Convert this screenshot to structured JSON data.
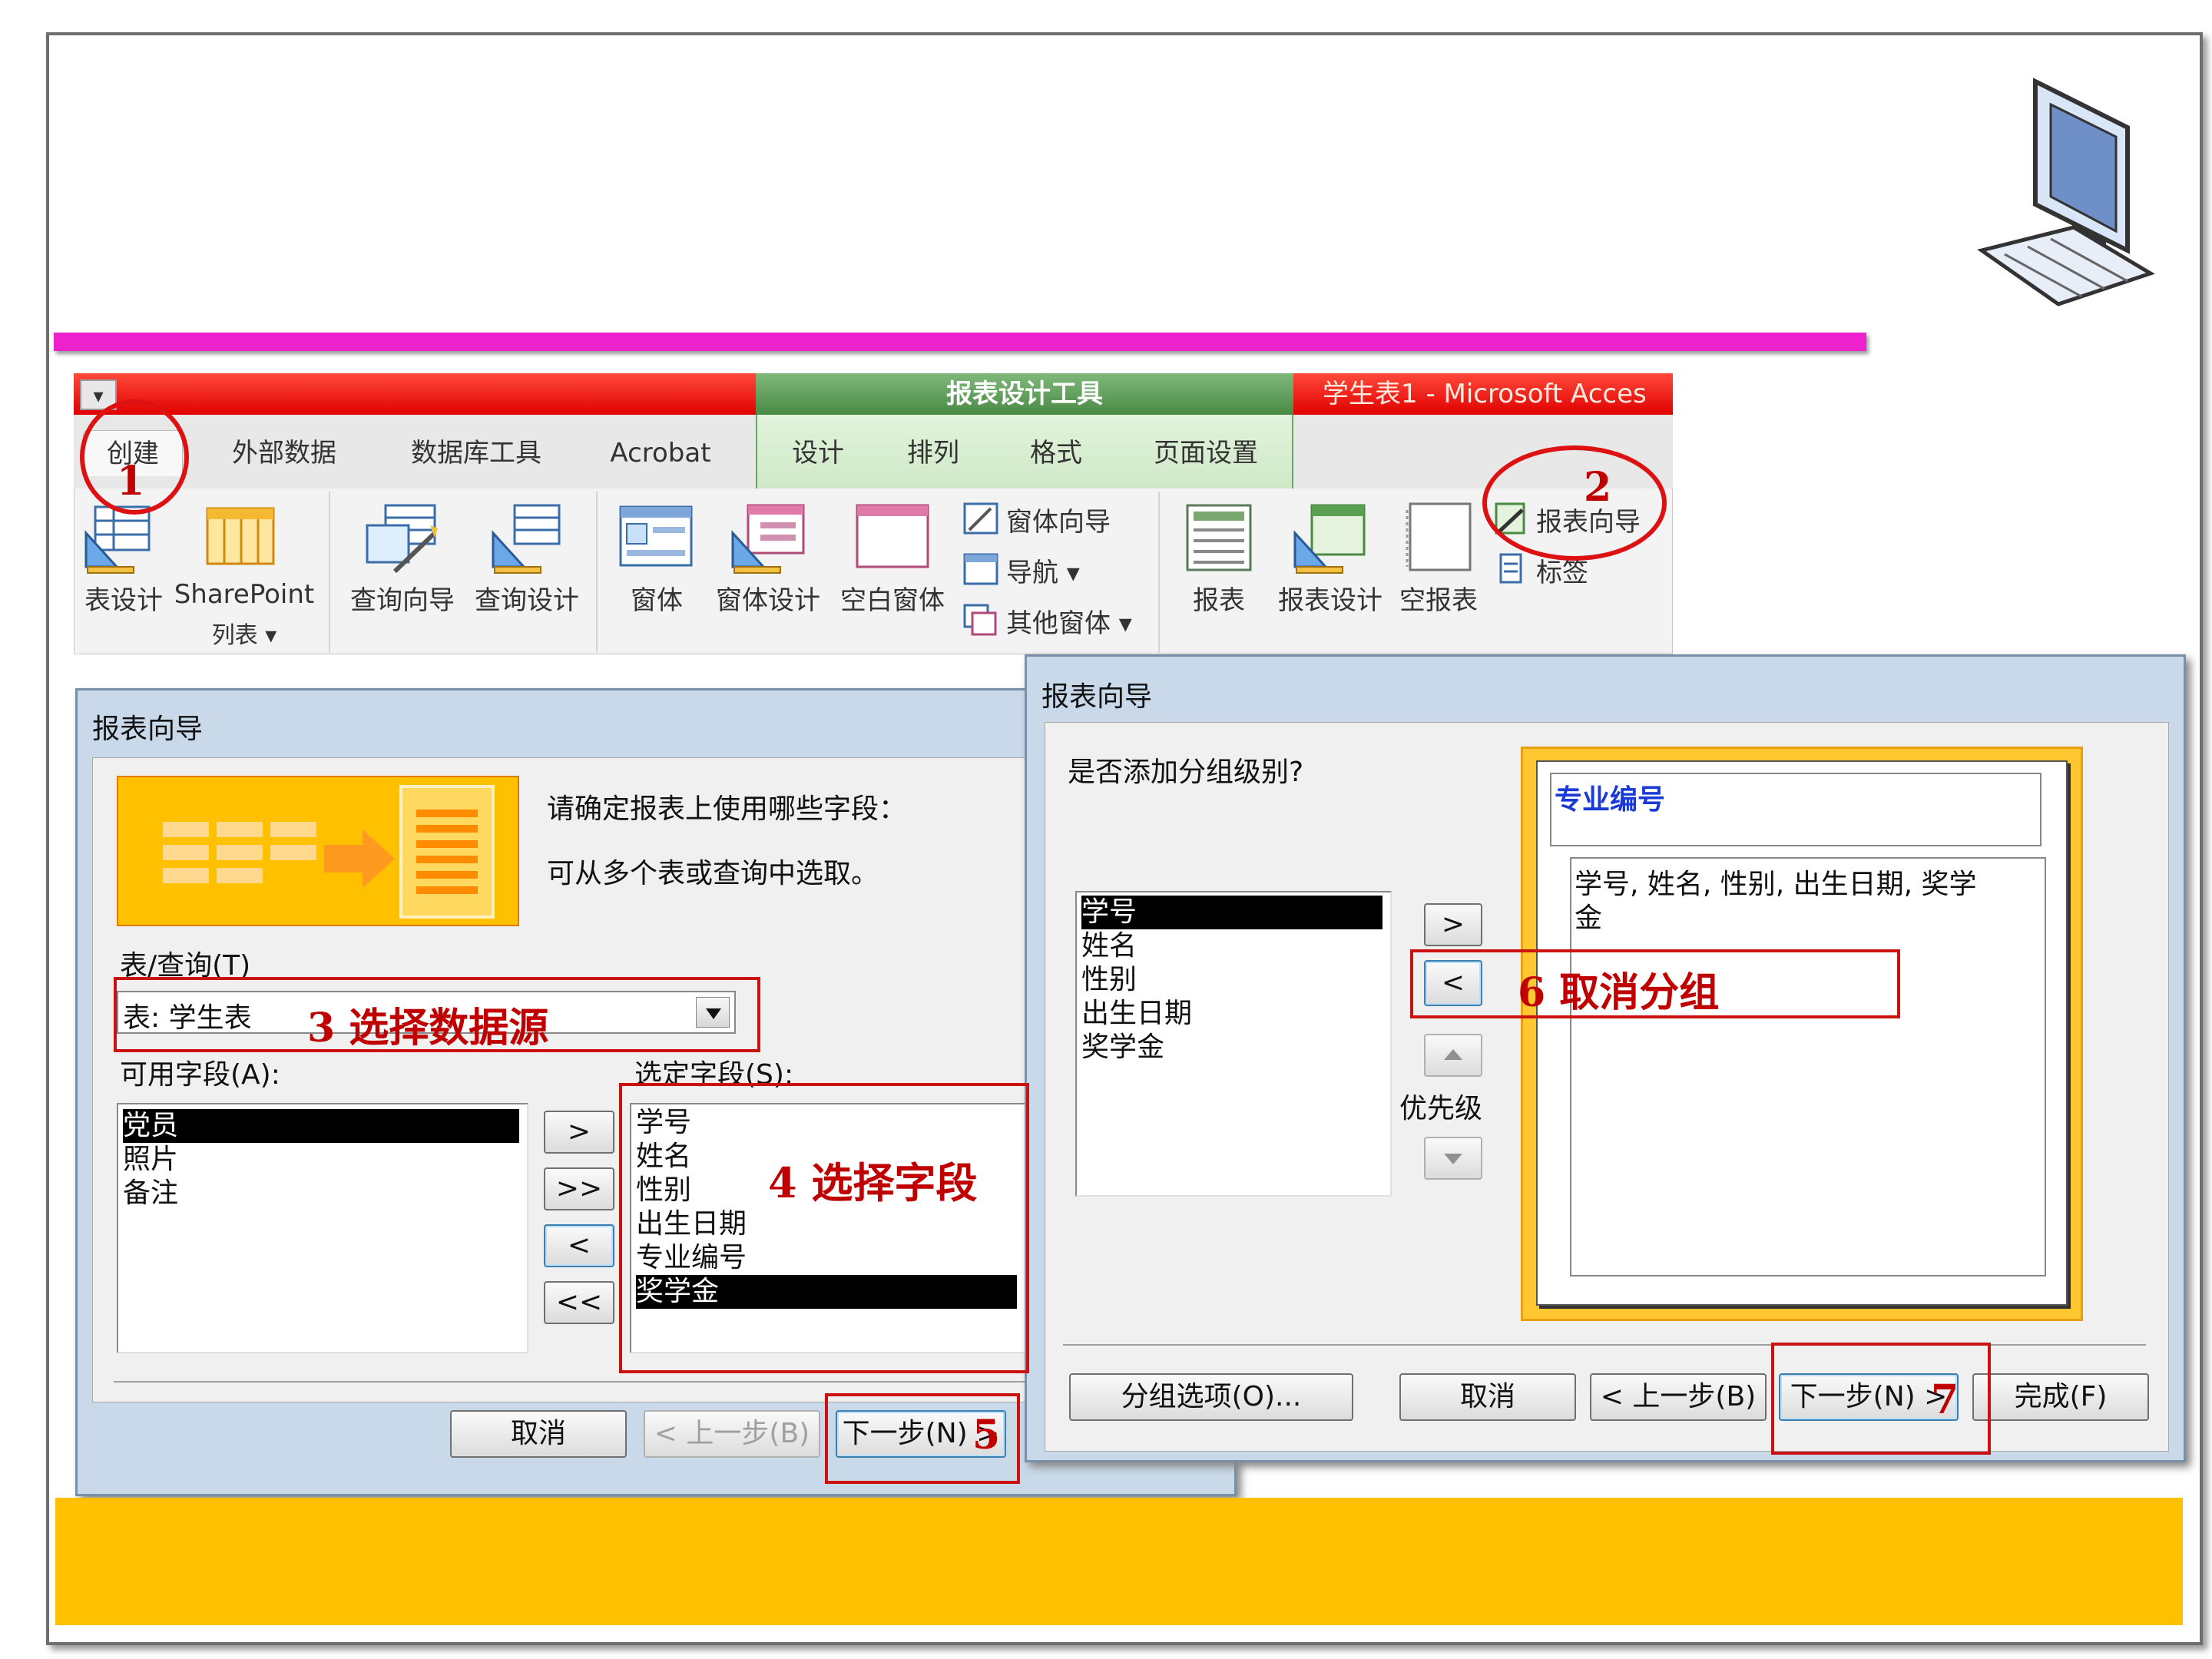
{
  "ribbon": {
    "qat_glyph": "▾",
    "context_tool": "报表设计工具",
    "window_title": "学生表1 - Microsoft Acces",
    "tabs": [
      "创建",
      "外部数据",
      "数据库工具",
      "Acrobat",
      "设计",
      "排列",
      "格式",
      "页面设置"
    ],
    "buttons": {
      "table_design": "表设计",
      "sharepoint": "SharePoint",
      "sharepoint_sub": "列表 ▾",
      "query_wizard": "查询向导",
      "query_design": "查询设计",
      "form": "窗体",
      "form_design": "窗体设计",
      "blank_form": "空白窗体",
      "form_wizard": "窗体向导",
      "navigation": "导航 ▾",
      "more_forms": "其他窗体 ▾",
      "report": "报表",
      "report_design": "报表设计",
      "blank_report": "空报表",
      "report_wizard": "报表向导",
      "labels": "标签"
    }
  },
  "dialog1": {
    "title": "报表向导",
    "prompt1": "请确定报表上使用哪些字段：",
    "prompt2": "可从多个表或查询中选取。",
    "table_label": "表/查询(T)",
    "table_value": "表: 学生表",
    "available_label": "可用字段(A):",
    "selected_label": "选定字段(S):",
    "available_fields": [
      "党员",
      "照片",
      "备注"
    ],
    "selected_fields": [
      "学号",
      "姓名",
      "性别",
      "出生日期",
      "专业编号",
      "奖学金"
    ],
    "move_buttons": [
      ">",
      ">>",
      "<",
      "<<"
    ],
    "cancel": "取消",
    "back": "< 上一步(B)",
    "next": "下一步(N) >"
  },
  "dialog2": {
    "title": "报表向导",
    "question": "是否添加分组级别?",
    "fields": [
      "学号",
      "姓名",
      "性别",
      "出生日期",
      "奖学金"
    ],
    "group_field": "专业编号",
    "detail_line1": "学号, 姓名, 性别, 出生日期, 奖学",
    "detail_line2": "金",
    "move_right": ">",
    "move_left": "<",
    "priority_label": "优先级",
    "group_options": "分组选项(O)...",
    "cancel": "取消",
    "back": "< 上一步(B)",
    "next": "下一步(N) >",
    "finish": "完成(F)"
  },
  "annotations": {
    "n1": "1",
    "n2": "2",
    "n3": "3 选择数据源",
    "n4": "4  选择字段",
    "n5": "5",
    "n6": "6  取消分组",
    "n7": "7"
  },
  "colors": {
    "accent_magenta": "#ee22cc",
    "footer_yellow": "#ffc000",
    "annotation_red": "#c00000",
    "title_red": "#e00000",
    "context_green": "#4a8a45"
  }
}
